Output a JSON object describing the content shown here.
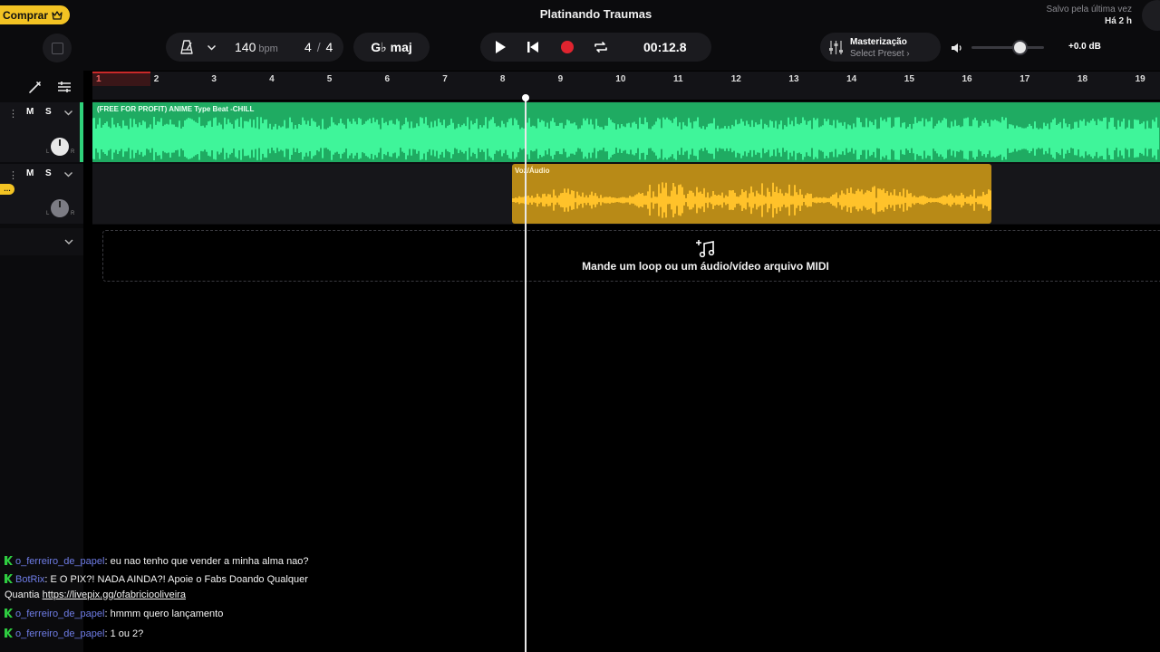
{
  "header": {
    "buy_label": "Comprar",
    "project_title": "Platinando Traumas",
    "saved_line1": "Salvo pela última vez",
    "saved_line2": "Há 2 h"
  },
  "tempo": {
    "bpm": "140",
    "bpm_unit": "bpm",
    "sig_top": "4",
    "sig_bottom": "4",
    "key": "G♭ maj"
  },
  "transport": {
    "time": "00:12.8"
  },
  "mastering": {
    "title": "Masterização",
    "preset": "Select Preset ›"
  },
  "volume": {
    "db": "+0.0 dB",
    "level": 0.6
  },
  "tracks": [
    {
      "mute": "M",
      "solo": "S",
      "clip_label": "(FREE FOR PROFIT) ANIME Type Beat -CHILL",
      "color": "#1fab62"
    },
    {
      "mute": "M",
      "solo": "S",
      "clip_label": "Voz/Áudio",
      "color": "#b88a17"
    }
  ],
  "ruler": {
    "bars": [
      "1",
      "2",
      "3",
      "4",
      "5",
      "6",
      "7",
      "8",
      "9",
      "10",
      "11",
      "12",
      "13",
      "14",
      "15",
      "16",
      "17",
      "18",
      "19"
    ]
  },
  "drop_zone": {
    "text": "Mande um loop ou um áudio/vídeo arquivo MIDI"
  },
  "chat": [
    {
      "user": "o_ferreiro_de_papel",
      "text": "eu nao tenho que vender a minha alma nao?"
    },
    {
      "user": "BotRix",
      "text": "E O PIX?! NADA AINDA?! Apoie o Fabs Doando Qualquer",
      "text2": "Quantia",
      "link": "https://livepix.gg/ofabriciooliveira"
    },
    {
      "user": "o_ferreiro_de_papel",
      "text": "hmmm quero lançamento"
    },
    {
      "user": "o_ferreiro_de_papel",
      "text": "1 ou 2?"
    }
  ],
  "colors": {
    "accent": "#f3c323",
    "record": "#e0242f",
    "green_track": "#1fab62",
    "yellow_track": "#b88a17"
  }
}
